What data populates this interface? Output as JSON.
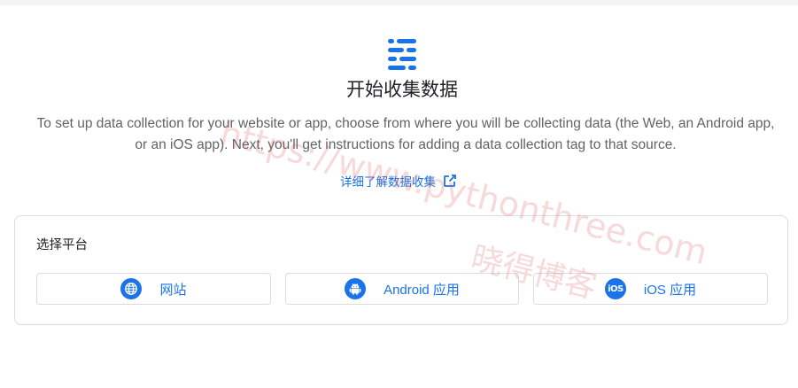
{
  "header": {
    "icon": "data-stream-icon",
    "title": "开始收集数据"
  },
  "description": "To set up data collection for your website or app, choose from where you will be collecting data (the Web, an Android app, or an iOS app). Next, you'll get instructions for adding a data collection tag to that source.",
  "learn_more": {
    "label": "详细了解数据收集",
    "icon": "open-in-new-icon"
  },
  "platform_card": {
    "label": "选择平台",
    "platforms": [
      {
        "label": "网站",
        "icon": "globe-icon"
      },
      {
        "label": "Android 应用",
        "icon": "android-icon"
      },
      {
        "label": "iOS 应用",
        "icon": "ios-icon",
        "icon_text": "iOS"
      }
    ]
  },
  "watermark": {
    "url": "https://www.pythonthree.com",
    "name": "晓得博客"
  },
  "colors": {
    "accent": "#1a73e8",
    "text_primary": "#202124",
    "text_secondary": "#5f6368",
    "border": "#dadce0"
  }
}
